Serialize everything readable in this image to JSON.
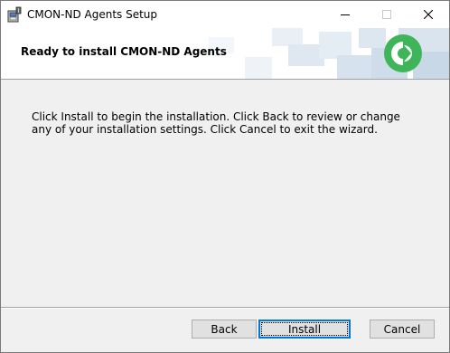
{
  "window": {
    "title": "CMON-ND Agents Setup",
    "icons": {
      "app": "installer-icon",
      "minimize": "minimize-icon",
      "maximize": "maximize-icon",
      "close": "close-icon"
    }
  },
  "banner": {
    "heading": "Ready to install CMON-ND Agents",
    "logo": "cmon-logo-icon",
    "logo_color": "#3fb559"
  },
  "body": {
    "message": "Click Install to begin the installation. Click Back to review or change any of your installation settings. Click Cancel to exit the wizard."
  },
  "buttons": {
    "back": "Back",
    "install": "Install",
    "cancel": "Cancel"
  },
  "colors": {
    "focus_border": "#0078d7",
    "button_face": "#e1e1e1",
    "dialog_bg": "#f0f0f0"
  }
}
